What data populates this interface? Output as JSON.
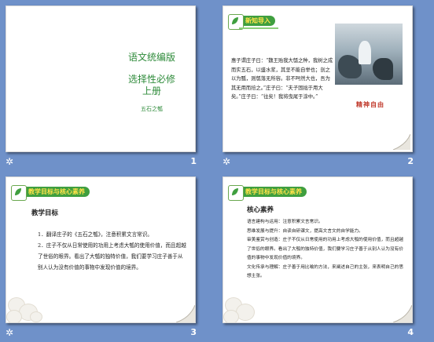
{
  "slides": [
    {
      "number": "1",
      "title_line1": "语文统编版",
      "title_line2": "选择性必修\n上册",
      "title_line3": "五石之瓠"
    },
    {
      "number": "2",
      "banner": "新知导入",
      "body": "惠子谓庄子曰：“魏王贻我大瓠之种，我树之成而实五石，以盛水浆，其坚不能自举也；剖之以为瓢，则瓠落无所容。非不呺然大也，吾为其无用而掊之。”庄子曰：“夫子固拙于用大矣。”庄子曰：“往矣！我将曳尾于涂中。”",
      "red_text": "精神自由"
    },
    {
      "number": "3",
      "banner": "教学目标与核心素养",
      "subtitle": "教学目标",
      "items": [
        "1．翻译庄子的《五石之瓠》，注意积累文言常识。",
        "2．庄子不仅从日常使用的功用上考虑大瓠的使用价值，而且超越了世俗的眼界。看出了大瓠的独特价值，我们要学习庄子善于从别人认为没有价值的事物中发现价值的境界。"
      ]
    },
    {
      "number": "4",
      "banner": "教学目标与核心素养",
      "subtitle": "核心素养",
      "items": [
        "语言建构与运用：注意积累文言常识。",
        "思维发展与提升：自读自研课文，提高文言文的自学能力。",
        "审美鉴赏与创造：庄子不仅从日常使用的功用上考虑大瓠的使用价值，而且超越了世俗的眼界。看出了大瓠的独特价值，我们要学习庄子善于从别人认为没有价值的事物中发现价值的境界。",
        "文化传承与理解：庄子善于用比喻的方法，来阐述自己的主张，来表明自己的思想主张。"
      ]
    }
  ],
  "colors": {
    "background": "#6f91c9",
    "title_green": "#2e8b3a",
    "banner_green": "#3f9f3f",
    "banner_text": "#ffe24a",
    "accent_red": "#c0392b"
  },
  "icons": {
    "slide_marker": "star-icon"
  }
}
